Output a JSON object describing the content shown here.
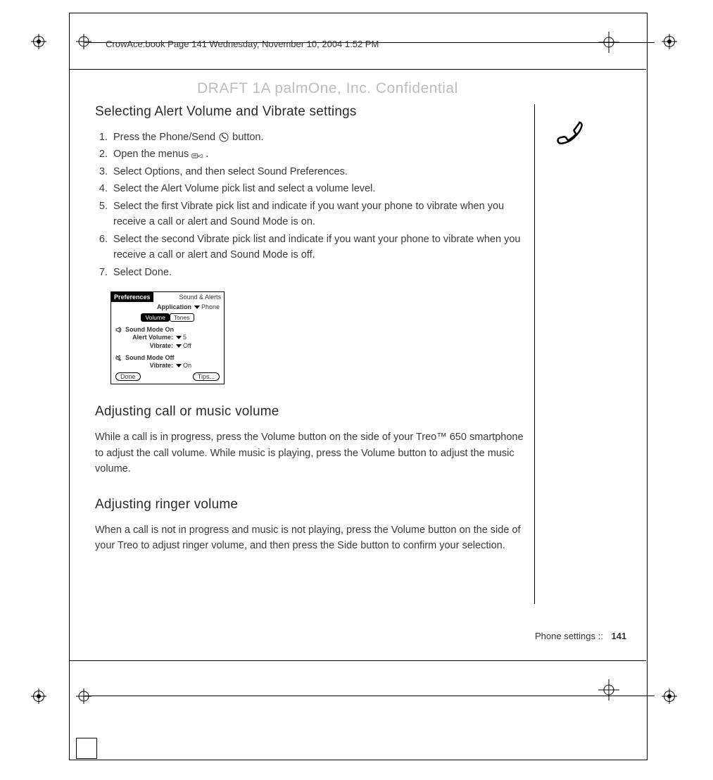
{
  "running_header": "CrowAce.book  Page 141  Wednesday, November 10, 2004  1:52 PM",
  "watermark": "DRAFT 1A  palmOne, Inc.   Confidential",
  "section1": {
    "title": "Selecting Alert Volume and Vibrate settings",
    "steps": {
      "s1a": "Press the Phone/Send ",
      "s1b": " button.",
      "s2a": "Open the menus ",
      "s2b": ".",
      "s3": "Select Options, and then select Sound Preferences.",
      "s4": "Select the Alert Volume pick list and select a volume level.",
      "s5": "Select the first Vibrate pick list and indicate if you want your phone to vibrate when you receive a call or alert and Sound Mode is on.",
      "s6": "Select the second Vibrate pick list and indicate if you want your phone to vibrate when you receive a call or alert and Sound Mode is off.",
      "s7": "Select Done."
    }
  },
  "screenshot": {
    "title_left": "Preferences",
    "title_right": "Sound & Alerts",
    "app_label": "Application",
    "app_value": "Phone",
    "tab_volume": "Volume",
    "tab_tones": "Tones",
    "mode_on": "Sound Mode On",
    "alert_vol_label": "Alert Volume:",
    "alert_vol_value": "5",
    "vib_label": "Vibrate:",
    "vib_on_value": "Off",
    "mode_off": "Sound Mode Off",
    "vib_off_value": "On",
    "btn_done": "Done",
    "btn_tips": "Tips..."
  },
  "section2": {
    "title": "Adjusting call or music volume",
    "body": "While a call is in progress, press the Volume button on the side of your Treo™ 650 smartphone to adjust the call volume. While music is playing, press the Volume button to adjust the music volume."
  },
  "section3": {
    "title": "Adjusting ringer volume",
    "body": "When a call is not in progress and music is not playing, press the Volume button on the side of your Treo to adjust ringer volume, and then press the Side button to confirm your selection."
  },
  "footer": {
    "label": "Phone settings   ::",
    "page": "141"
  }
}
